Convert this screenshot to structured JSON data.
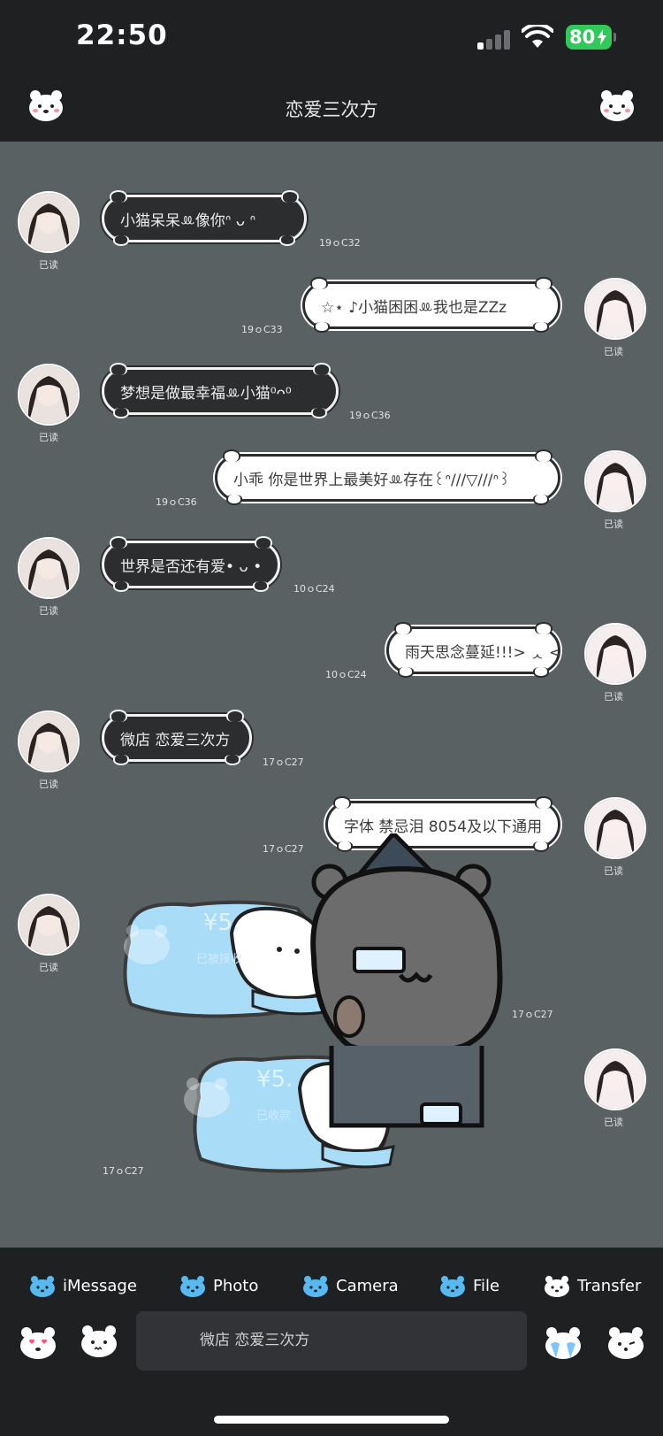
{
  "status": {
    "time": "22:50",
    "battery": "80"
  },
  "header": {
    "title": "恋爱三次方"
  },
  "messages": [
    {
      "side": "left",
      "text": "小猫呆呆ꔛ像你ᐢ ᴗ ᐢ",
      "time": "19ｏC32",
      "read": "已读"
    },
    {
      "side": "right",
      "text": "☆⋆ ♪小猫困困ꔛ我也是ZZz",
      "time": "19ｏC33",
      "read": "已读"
    },
    {
      "side": "left",
      "text": "梦想是做最幸福ꔛ小猫⁰ᴖ⁰",
      "time": "19ｏC36",
      "read": "已读"
    },
    {
      "side": "right",
      "text": "小乖 你是世界上最美好ꔛ存在꒰ᐢ///▽///ᐢ꒱",
      "time": "19ｏC36",
      "read": "已读"
    },
    {
      "side": "left",
      "text": "世界是否还有爱• ᴗ •",
      "time": "10ｏC24",
      "read": "已读"
    },
    {
      "side": "right",
      "text": "雨天思念蔓延!!!> ᆺ <",
      "time": "10ｏC24",
      "read": "已读"
    },
    {
      "side": "left",
      "text": "微店 恋爱三次方",
      "time": "17ｏC27",
      "read": "已读"
    },
    {
      "side": "right",
      "text": "字体 禁忌泪 8054及以下通用",
      "time": "17ｏC27",
      "read": "已读"
    }
  ],
  "transfers": [
    {
      "amount": "¥5.",
      "status": "已被接收",
      "time": "17ｏC27",
      "read": "已读"
    },
    {
      "amount": "¥5.",
      "status": "已收款",
      "time": "17ｏC27",
      "read": "已读"
    }
  ],
  "toolbar": {
    "items": [
      "iMessage",
      "Photo",
      "Camera",
      "File",
      "Transfer"
    ],
    "input_text": "微店 恋爱三次方"
  },
  "colors": {
    "chat_bg": "#596163",
    "bar_bg": "#1f2022",
    "battery": "#30c95a",
    "transfer_blue": "#a9dcf7"
  }
}
